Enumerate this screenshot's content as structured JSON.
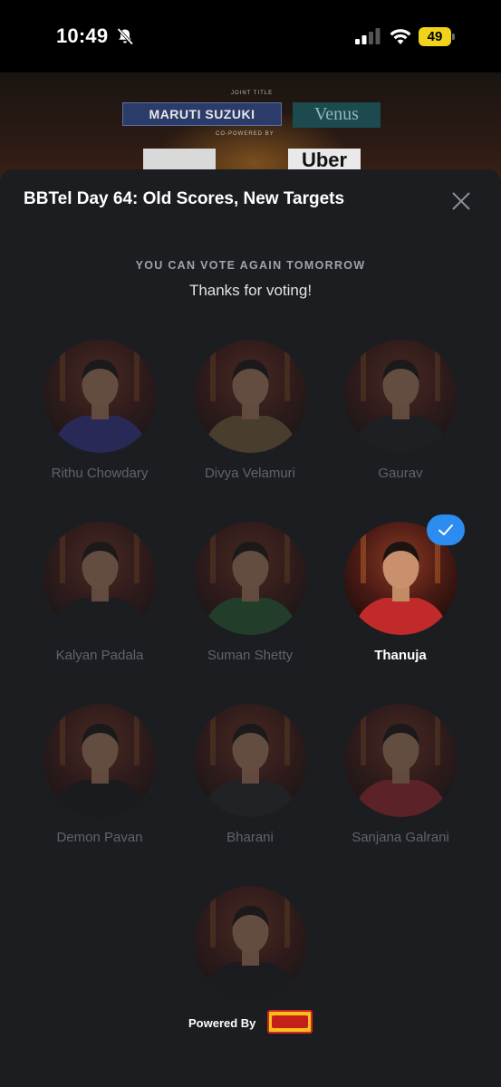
{
  "status_bar": {
    "time": "10:49",
    "battery": "49"
  },
  "banner": {
    "joint_title_tag": "JOINT TITLE",
    "co_powered_tag": "CO-POWERED BY",
    "sponsor_1": "MARUTI SUZUKI",
    "sponsor_2": "Venus",
    "sponsor_3": "Uber"
  },
  "modal": {
    "title": "BBTel Day 64: Old Scores, New Targets",
    "vote_notice": "YOU CAN VOTE AGAIN TOMORROW",
    "thanks": "Thanks for voting!"
  },
  "contestants": [
    {
      "name": "Rithu Chowdary",
      "selected": false,
      "shirt": "#3a3aa0"
    },
    {
      "name": "Divya Velamuri",
      "selected": false,
      "shirt": "#8a6a40"
    },
    {
      "name": "Gaurav",
      "selected": false,
      "shirt": "#222226"
    },
    {
      "name": "Kalyan Padala",
      "selected": false,
      "shirt": "#1d1d22"
    },
    {
      "name": "Suman Shetty",
      "selected": false,
      "shirt": "#2f6a3a"
    },
    {
      "name": "Thanuja",
      "selected": true,
      "shirt": "#c02a2a"
    },
    {
      "name": "Demon Pavan",
      "selected": false,
      "shirt": "#1a1a1d"
    },
    {
      "name": "Bharani",
      "selected": false,
      "shirt": "#2a2a2e"
    },
    {
      "name": "Sanjana Galrani",
      "selected": false,
      "shirt": "#b52a32"
    },
    {
      "name": "",
      "selected": false,
      "shirt": "#1c1c20"
    }
  ],
  "footer": {
    "powered_by": "Powered By"
  },
  "colors": {
    "modal_bg": "#1b1d21",
    "accent_check": "#2d8cf0",
    "name_dim": "#5f636b",
    "battery": "#f2d31b"
  }
}
